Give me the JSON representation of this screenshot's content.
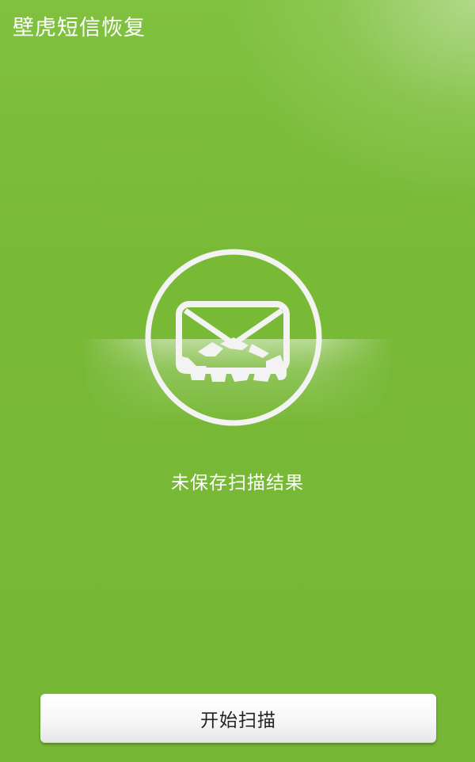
{
  "app": {
    "title": "壁虎短信恢复"
  },
  "scan": {
    "status_text": "未保存扫描结果",
    "icon": "sms-envelope-scan-icon"
  },
  "actions": {
    "start_scan_label": "开始扫描"
  },
  "colors": {
    "background": "#76b836",
    "text": "#ffffff",
    "button_background": "#f5f5f5",
    "button_text": "#222222"
  }
}
